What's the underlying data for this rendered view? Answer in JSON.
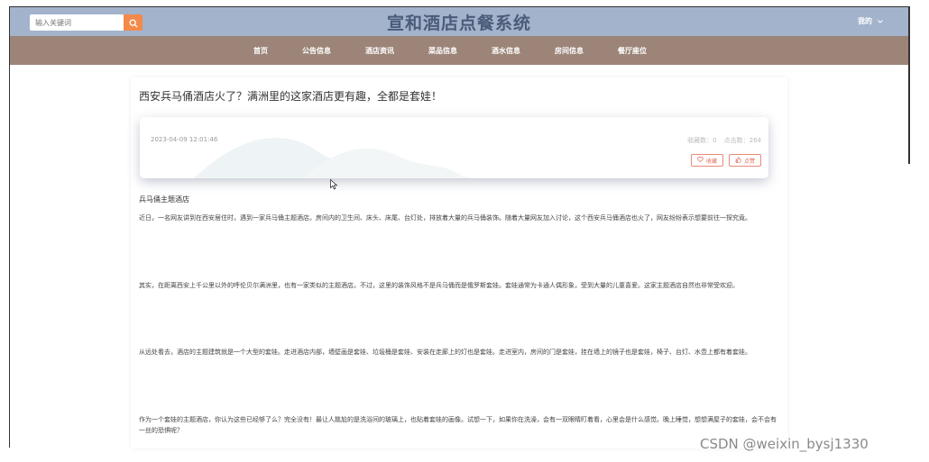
{
  "header": {
    "title": "宣和酒店点餐系统",
    "search_placeholder": "输入关键词",
    "user_label": "我的",
    "colors": {
      "topbar": "#a3b3cc",
      "navbar": "#9c8478",
      "search_button": "#f48a4a"
    }
  },
  "nav": {
    "items": [
      {
        "label": "首页"
      },
      {
        "label": "公告信息"
      },
      {
        "label": "酒店资讯"
      },
      {
        "label": "菜品信息"
      },
      {
        "label": "酒水信息"
      },
      {
        "label": "房间信息"
      },
      {
        "label": "餐厅座位"
      }
    ]
  },
  "article": {
    "title": "西安兵马俑酒店火了？满洲里的这家酒店更有趣，全都是套娃！",
    "date": "2023-04-09 12:01:46",
    "collect_count_label": "收藏数：0",
    "click_count_label": "点击数：264",
    "collect_button": "收藏",
    "like_button": "点赞",
    "section_heading": "兵马俑主题酒店",
    "paragraphs": [
      "近日，一名网友讲到在西安居住时，遇到一家兵马俑主题酒店。房间内的卫生间、床头、床尾、台灯处，排放着大量的兵马俑装饰。随着大量网友加入讨论，这个西安兵马俑酒店也火了，网友纷纷表示想要前往一探究竟。",
      "其实，在距离西安上千公里以外的呼伦贝尔满洲里，也有一家类似的主题酒店。不过，这里的装饰风格不是兵马俑而是俄罗斯套娃。套娃通常为卡通人偶形象，受到大量的儿童喜爱。这家主题酒店自然也非常受欢迎。",
      "从远处看去，酒店的主题建筑就是一个大型的套娃。走进酒店内部，墙壁画是套娃、垃圾桶是套娃、安装在走廊上的灯也是套娃。走进室内，房间的门是套娃，挂在墙上的镜子也是套娃，椅子、台灯、水壶上都有着套娃。",
      "作为一个套娃的主题酒店，你认为这些已经够了么？完全没有！最让人尴尬的是洗浴间的玻璃上，也贴着套娃的画像。试想一下，如果你在洗澡，会有一双眼睛盯着看，心里会是什么感觉。晚上睡觉，想想满屋子的套娃，会不会有一丝的恐惧呢？"
    ]
  },
  "watermark": "CSDN @weixin_bysj1330"
}
